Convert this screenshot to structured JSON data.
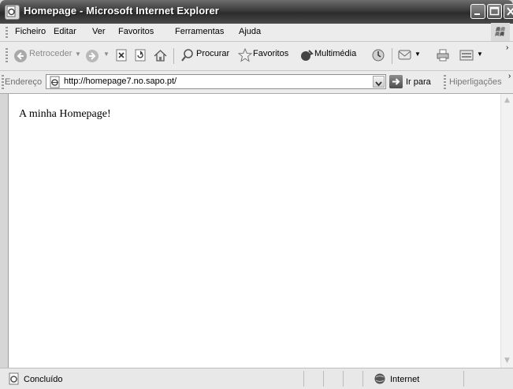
{
  "window": {
    "title": "Homepage - Microsoft Internet Explorer"
  },
  "menu": {
    "items": [
      "Ficheiro",
      "Editar",
      "Ver",
      "Favoritos",
      "Ferramentas",
      "Ajuda"
    ]
  },
  "toolbar": {
    "back_label": "Retroceder",
    "search_label": "Procurar",
    "favorites_label": "Favoritos",
    "media_label": "Multimédia"
  },
  "address": {
    "label": "Endereço",
    "url": "http://homepage7.no.sapo.pt/",
    "go_label": "Ir para",
    "links_label": "Hiperligações"
  },
  "page": {
    "text": "A minha Homepage!"
  },
  "status": {
    "text": "Concluído",
    "zone": "Internet"
  }
}
